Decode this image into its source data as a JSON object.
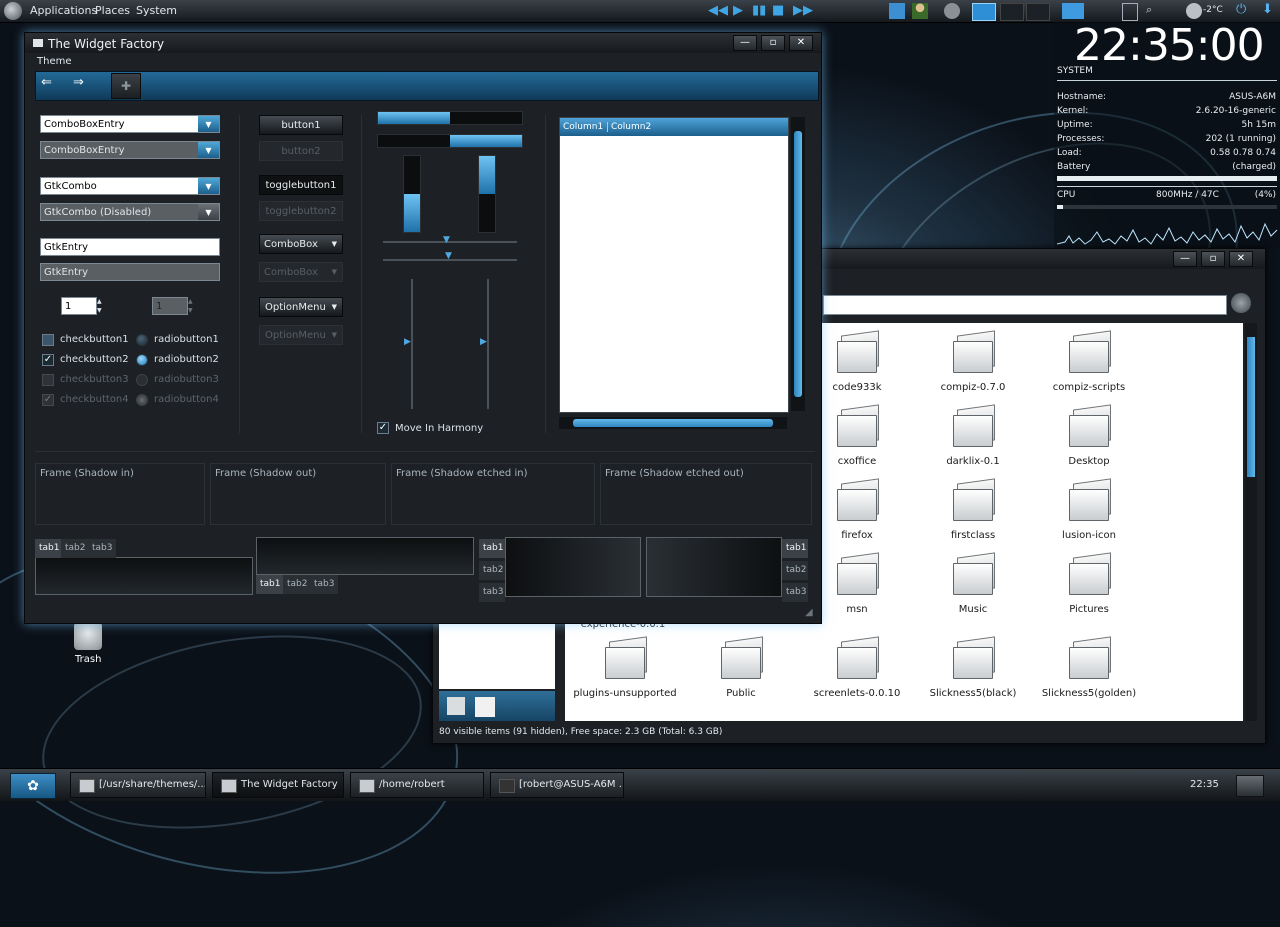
{
  "top_panel": {
    "menus": [
      "Applications",
      "Places",
      "System"
    ],
    "temperature": "-2°C"
  },
  "widget_factory": {
    "title": "The Widget Factory",
    "menubar": [
      "Theme"
    ],
    "column1": {
      "combo_entry_1": "ComboBoxEntry",
      "combo_entry_2": "ComboBoxEntry",
      "gtk_combo": "GtkCombo",
      "gtk_combo_disabled": "GtkCombo (Disabled)",
      "gtk_entry_1": "GtkEntry",
      "gtk_entry_2": "GtkEntry",
      "spin_1": "1",
      "spin_2": "1",
      "checks": [
        "checkbutton1",
        "checkbutton2",
        "checkbutton3",
        "checkbutton4"
      ],
      "radios": [
        "radiobutton1",
        "radiobutton2",
        "radiobutton3",
        "radiobutton4"
      ]
    },
    "column2": {
      "button1": "button1",
      "button2": "button2",
      "togglebutton1": "togglebutton1",
      "togglebutton2": "togglebutton2",
      "combobox1": "ComboBox",
      "combobox2": "ComboBox",
      "optionmenu1": "OptionMenu",
      "optionmenu2": "OptionMenu"
    },
    "column3": {
      "move_in_harmony": "Move In Harmony",
      "progress_h1": 0.5,
      "progress_h2": 0.5,
      "progress_v1": 0.5,
      "progress_v2": 0.5
    },
    "treeview": {
      "columns": [
        "Column1",
        "Column2"
      ]
    },
    "frames": [
      "Frame (Shadow in)",
      "Frame (Shadow out)",
      "Frame (Shadow etched in)",
      "Frame (Shadow etched out)"
    ],
    "tabs": [
      "tab1",
      "tab2",
      "tab3"
    ]
  },
  "conky": {
    "clock": "22:35:00",
    "section": "SYSTEM",
    "rows": [
      {
        "label": "Hostname:",
        "value": "ASUS-A6M"
      },
      {
        "label": "Kernel:",
        "value": "2.6.20-16-generic"
      },
      {
        "label": "Uptime:",
        "value": "5h 15m"
      },
      {
        "label": "Processes:",
        "value": "202 (1 running)"
      },
      {
        "label": "Load:",
        "value": "0.58 0.78 0.74"
      },
      {
        "label": "Battery",
        "value": "(charged)"
      }
    ],
    "cpu_label": "CPU",
    "cpu_freq": "800MHz / 47C",
    "cpu_pct": "(4%)"
  },
  "file_manager": {
    "statusbar": "80 visible items (91 hidden), Free space: 2.3 GB (Total: 6.3 GB)",
    "partial_label": "experience-0.0.1",
    "items": [
      "code933k",
      "compiz-0.7.0",
      "compiz-scripts",
      "cxoffice",
      "darklix-0.1",
      "Desktop",
      "firefox",
      "firstclass",
      "lusion-icon",
      "msn",
      "Music",
      "Pictures",
      "plugins-unsupported",
      "Public",
      "screenlets-0.0.10",
      "Slickness5(black)",
      "Slickness5(golden)"
    ]
  },
  "desktop": {
    "trash_label": "Trash"
  },
  "taskbar": {
    "tasks": [
      "[/usr/share/themes/...",
      "The Widget Factory",
      "/home/robert",
      "[robert@ASUS-A6M ..."
    ],
    "clock": "22:35"
  }
}
